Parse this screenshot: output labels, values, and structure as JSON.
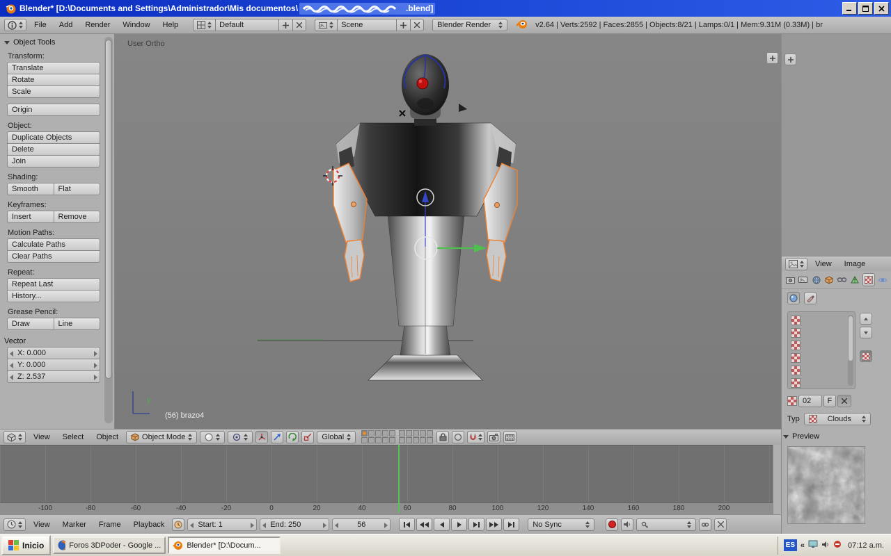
{
  "window": {
    "title_prefix": "Blender* [D:\\Documents and Settings\\Administrador\\Mis documentos\\",
    "title_suffix": ".blend]"
  },
  "info_header": {
    "menus": [
      "File",
      "Add",
      "Render",
      "Window",
      "Help"
    ],
    "layout_name": "Default",
    "scene_name": "Scene",
    "engine_name": "Blender Render",
    "stats": "v2.64 | Verts:2592 | Faces:2855 | Objects:8/21 | Lamps:0/1 | Mem:9.31M (0.33M) | br"
  },
  "tool_shelf": {
    "title": "Object Tools",
    "groups": [
      {
        "label": "Transform:",
        "buttons": [
          "Translate",
          "Rotate",
          "Scale"
        ]
      },
      {
        "label": "",
        "buttons": [
          "Origin"
        ]
      },
      {
        "label": "Object:",
        "buttons": [
          "Duplicate Objects",
          "Delete",
          "Join"
        ]
      },
      {
        "label": "Shading:",
        "buttons": [
          "Smooth",
          "Flat"
        ]
      },
      {
        "label": "Keyframes:",
        "buttons": [
          "Insert",
          "Remove"
        ]
      },
      {
        "label": "Motion Paths:",
        "buttons": [
          "Calculate Paths",
          "Clear Paths"
        ]
      },
      {
        "label": "Repeat:",
        "buttons": [
          "Repeat Last",
          "History..."
        ]
      },
      {
        "label": "Grease Pencil:",
        "buttons": [
          "Draw",
          "Line"
        ]
      }
    ],
    "vector": {
      "title": "Vector",
      "x": "X: 0.000",
      "y": "Y: 0.000",
      "z": "Z: 2.537"
    }
  },
  "viewport": {
    "view_label": "User Ortho",
    "active_object": "(56) brazo4",
    "axis_y_label": "y"
  },
  "viewport_header": {
    "menus": [
      "View",
      "Select",
      "Object"
    ],
    "mode": "Object Mode",
    "orientation": "Global"
  },
  "image_editor": {
    "menus": [
      "View",
      "Image"
    ]
  },
  "properties": {
    "name_value": "02",
    "fake_user": "F",
    "type_label": "Typ",
    "type_value": "Clouds",
    "preview_title": "Preview"
  },
  "timeline": {
    "ticks": [
      "-100",
      "-80",
      "-60",
      "-40",
      "-20",
      "0",
      "20",
      "40",
      "60",
      "80",
      "100",
      "120",
      "140",
      "160",
      "180",
      "200"
    ],
    "menus": [
      "View",
      "Marker",
      "Frame",
      "Playback"
    ],
    "start": "Start: 1",
    "end": "End: 250",
    "current_frame": "56",
    "sync_mode": "No Sync"
  },
  "taskbar": {
    "start_label": "Inicio",
    "tasks": [
      {
        "label": "Foros 3DPoder - Google ..."
      },
      {
        "label": "Blender* [D:\\Docum..."
      }
    ],
    "language_badge": "ES",
    "overflow_chevron": "«",
    "clock": "07:12 a.m."
  },
  "colors": {
    "titlebar_blue": "#1d49d8",
    "selection_orange": "#f08030",
    "frame_line_green": "#55c35a",
    "texture_checker_red": "#c05a5a"
  }
}
